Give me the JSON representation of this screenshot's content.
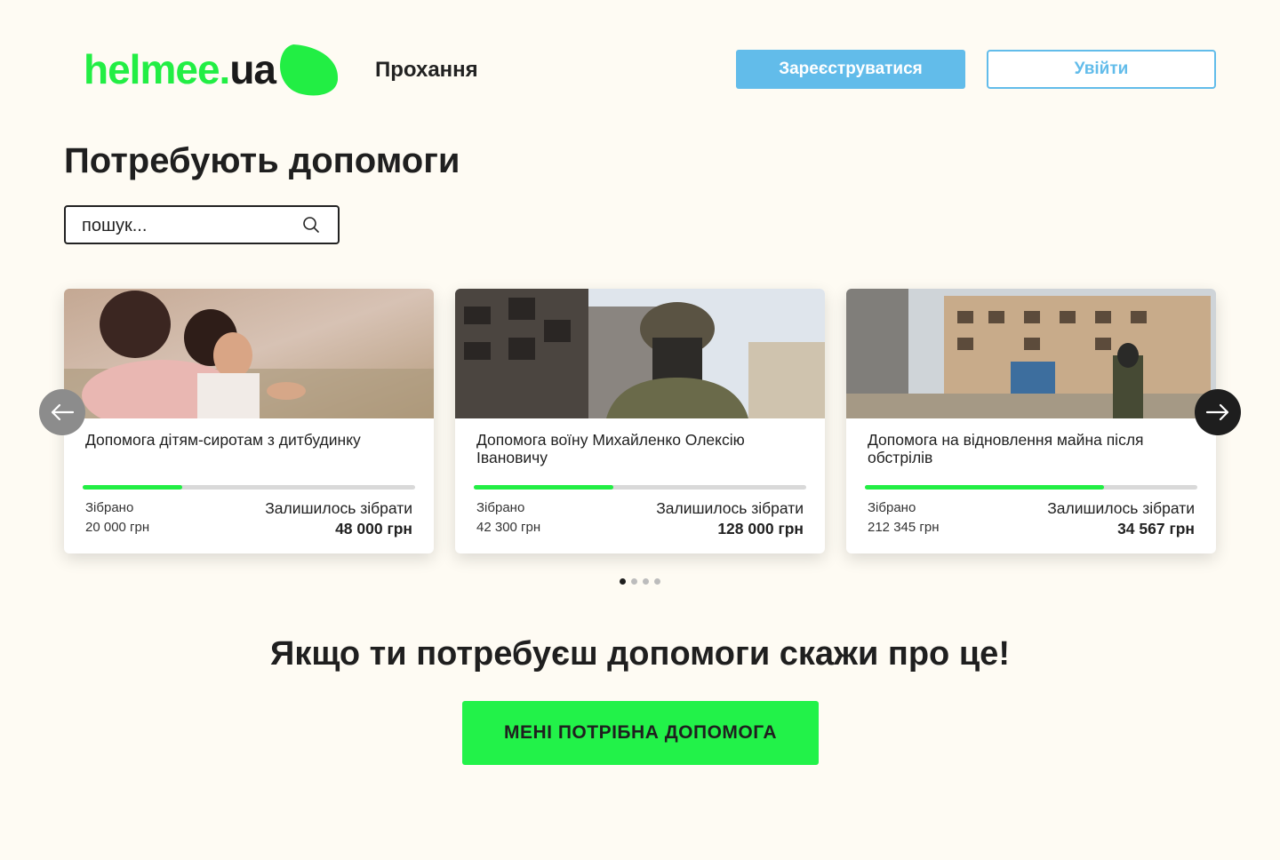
{
  "header": {
    "logo_main": "helmee.",
    "logo_ua": "ua",
    "nav_link": "Прохання",
    "register_label": "Зареєструватися",
    "login_label": "Увійти"
  },
  "main": {
    "title": "Потребують допомоги",
    "search_placeholder": "пошук..."
  },
  "cards": [
    {
      "title": "Допомога дітям-сиротам з дитбудинку",
      "raised_label": "Зібрано",
      "raised_value": "20 000 грн",
      "remaining_label": "Залишилось зібрати",
      "remaining_value": "48 000 грн",
      "progress": 0.3
    },
    {
      "title": "Допомога воїну Михайленко Олексію Івановичу",
      "raised_label": "Зібрано",
      "raised_value": "42 300 грн",
      "remaining_label": "Залишилось зібрати",
      "remaining_value": "128 000 грн",
      "progress": 0.42
    },
    {
      "title": "Допомога на відновлення майна після обстрілів",
      "raised_label": "Зібрано",
      "raised_value": "212 345 грн",
      "remaining_label": "Залишилось зібрати",
      "remaining_value": "34 567 грн",
      "progress": 0.72
    }
  ],
  "carousel": {
    "dots_count": 4,
    "active_dot": 0
  },
  "cta": {
    "heading": "Якщо ти потребуєш допомоги скажи про це!",
    "button_label": "МЕНІ ПОТРІБНА ДОПОМОГА"
  },
  "colors": {
    "background": "#fefbf3",
    "brand_green": "#22ee44",
    "accent_blue": "#62bcea",
    "progress_track": "#d9d9d9",
    "dark": "#1e1e1e"
  }
}
